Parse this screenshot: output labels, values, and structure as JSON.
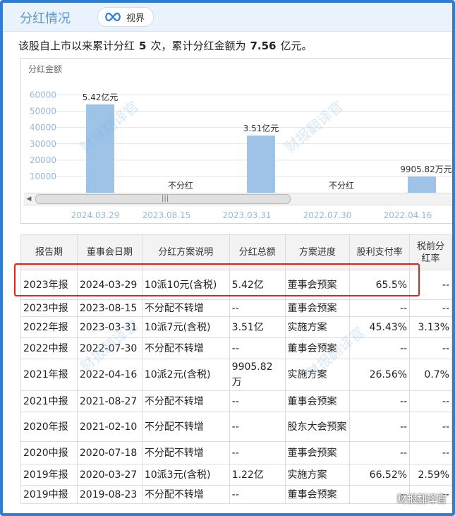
{
  "header": {
    "title": "分红情况",
    "tag_label": "视界"
  },
  "summary": {
    "prefix": "该股自上市以来累计分红",
    "count": "5",
    "mid": "次，累计分红金额为",
    "amount": "7.56",
    "suffix": "亿元。"
  },
  "chart_data": {
    "type": "bar",
    "title": "分红金额",
    "categories": [
      "2024.03.29",
      "2023.08.15",
      "2023.03.31",
      "2022.07.30",
      "2022.04.16"
    ],
    "values": [
      54200,
      0,
      35100,
      0,
      9905.82
    ],
    "labels": [
      "5.42亿元",
      "不分红",
      "3.51亿元",
      "不分红",
      "9905.82万元"
    ],
    "yticks": [
      "10000",
      "20000",
      "30000",
      "40000",
      "50000",
      "60000"
    ],
    "ylim": [
      0,
      65000
    ],
    "bar_color": "#9ec3e6",
    "grid": true
  },
  "table": {
    "headers": [
      "报告期",
      "董事会日期",
      "分红方案说明",
      "分红总额",
      "方案进度",
      "股利支付率",
      "税前分红率"
    ],
    "rows": [
      [
        "2023年报",
        "2024-03-29",
        "10派10元(含税)",
        "5.42亿",
        "董事会预案",
        "65.5%",
        "--"
      ],
      [
        "2023中报",
        "2023-08-15",
        "不分配不转增",
        "--",
        "董事会预案",
        "--",
        "--"
      ],
      [
        "2022年报",
        "2023-03-31",
        "10派7元(含税)",
        "3.51亿",
        "实施方案",
        "45.43%",
        "3.13%"
      ],
      [
        "2022中报",
        "2022-07-30",
        "不分配不转增",
        "--",
        "董事会预案",
        "--",
        "--"
      ],
      [
        "2021年报",
        "2022-04-16",
        "10派2元(含税)",
        "9905.82万",
        "实施方案",
        "26.56%",
        "0.7%"
      ],
      [
        "2021中报",
        "2021-08-27",
        "不分配不转增",
        "--",
        "董事会预案",
        "--",
        "--"
      ],
      [
        "2020年报",
        "2021-02-10",
        "不分配不转增",
        "--",
        "股东大会预案",
        "--",
        "--"
      ],
      [
        "2020中报",
        "2020-07-18",
        "不分配不转增",
        "--",
        "董事会预案",
        "--",
        "--"
      ],
      [
        "2019年报",
        "2020-03-27",
        "10派3元(含税)",
        "1.22亿",
        "实施方案",
        "66.52%",
        "2.59%"
      ],
      [
        "2019中报",
        "2019-08-23",
        "不分配不转增",
        "--",
        "董事会预案",
        "--",
        "--"
      ]
    ]
  },
  "watermark": "财报翻译官",
  "colors": {
    "frame": "#2c7fd6",
    "highlight": "#e0241d"
  }
}
